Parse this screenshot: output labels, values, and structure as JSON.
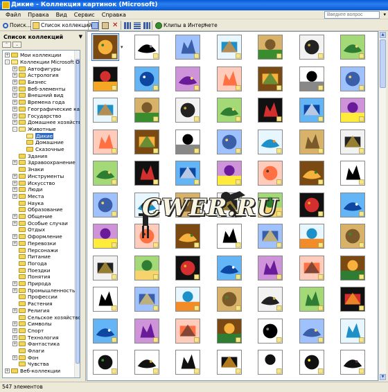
{
  "window": {
    "title": "Дикие - Коллекция картинок (Microsoft)"
  },
  "menu": {
    "items": [
      "Файл",
      "Правка",
      "Вид",
      "Сервис",
      "Справка"
    ],
    "help_placeholder": "Введите вопрос"
  },
  "toolbar": {
    "search_label": "Поиск...",
    "collections_label": "Список коллекций...",
    "web_clips_label": "Клипы в Интернете"
  },
  "left_panel": {
    "title": "Список коллекций",
    "tree": [
      {
        "label": "Мои коллекции",
        "indent": 0,
        "exp": "+"
      },
      {
        "label": "Коллекции Microsoft Office",
        "indent": 0,
        "exp": "-"
      },
      {
        "label": "Автофигуры",
        "indent": 1,
        "exp": "+"
      },
      {
        "label": "Астрология",
        "indent": 1,
        "exp": "+"
      },
      {
        "label": "Бизнес",
        "indent": 1,
        "exp": "+"
      },
      {
        "label": "Веб-элементы",
        "indent": 1,
        "exp": "+"
      },
      {
        "label": "Внешний вид",
        "indent": 1,
        "exp": "+"
      },
      {
        "label": "Времена года",
        "indent": 1,
        "exp": "+"
      },
      {
        "label": "Географические карты",
        "indent": 1,
        "exp": "+"
      },
      {
        "label": "Государство",
        "indent": 1,
        "exp": "+"
      },
      {
        "label": "Домашнее хозяйство",
        "indent": 1,
        "exp": "+"
      },
      {
        "label": "Животные",
        "indent": 1,
        "exp": "-"
      },
      {
        "label": "Дикие",
        "indent": 2,
        "exp": "",
        "selected": true
      },
      {
        "label": "Домашние",
        "indent": 2,
        "exp": ""
      },
      {
        "label": "Сказочные",
        "indent": 2,
        "exp": ""
      },
      {
        "label": "Здания",
        "indent": 1,
        "exp": ""
      },
      {
        "label": "Здравоохранение",
        "indent": 1,
        "exp": "+"
      },
      {
        "label": "Знаки",
        "indent": 1,
        "exp": ""
      },
      {
        "label": "Инструменты",
        "indent": 1,
        "exp": "+"
      },
      {
        "label": "Искусство",
        "indent": 1,
        "exp": "+"
      },
      {
        "label": "Люди",
        "indent": 1,
        "exp": "+"
      },
      {
        "label": "Места",
        "indent": 1,
        "exp": "+"
      },
      {
        "label": "Наука",
        "indent": 1,
        "exp": ""
      },
      {
        "label": "Образование",
        "indent": 1,
        "exp": ""
      },
      {
        "label": "Общение",
        "indent": 1,
        "exp": "+"
      },
      {
        "label": "Особые случаи",
        "indent": 1,
        "exp": "+"
      },
      {
        "label": "Отдых",
        "indent": 1,
        "exp": ""
      },
      {
        "label": "Оформление",
        "indent": 1,
        "exp": "+"
      },
      {
        "label": "Перевозки",
        "indent": 1,
        "exp": "+"
      },
      {
        "label": "Персонажи",
        "indent": 1,
        "exp": ""
      },
      {
        "label": "Питание",
        "indent": 1,
        "exp": ""
      },
      {
        "label": "Погода",
        "indent": 1,
        "exp": ""
      },
      {
        "label": "Поездки",
        "indent": 1,
        "exp": ""
      },
      {
        "label": "Понятия",
        "indent": 1,
        "exp": ""
      },
      {
        "label": "Природа",
        "indent": 1,
        "exp": "+"
      },
      {
        "label": "Промышленность",
        "indent": 1,
        "exp": "+"
      },
      {
        "label": "Професcии",
        "indent": 1,
        "exp": ""
      },
      {
        "label": "Растения",
        "indent": 1,
        "exp": ""
      },
      {
        "label": "Религия",
        "indent": 1,
        "exp": "+"
      },
      {
        "label": "Сельское хозяйство",
        "indent": 1,
        "exp": ""
      },
      {
        "label": "Символы",
        "indent": 1,
        "exp": "+"
      },
      {
        "label": "Спорт",
        "indent": 1,
        "exp": "+"
      },
      {
        "label": "Технология",
        "indent": 1,
        "exp": "+"
      },
      {
        "label": "Фантастика",
        "indent": 1,
        "exp": "+"
      },
      {
        "label": "Флаги",
        "indent": 1,
        "exp": ""
      },
      {
        "label": "Фон",
        "indent": 1,
        "exp": "+"
      },
      {
        "label": "Чувства",
        "indent": 1,
        "exp": ""
      },
      {
        "label": "Веб-коллекции",
        "indent": 0,
        "exp": "+"
      }
    ]
  },
  "grid": {
    "thumbnails": [
      [
        "tiger",
        "white-bird",
        "pelican-sign",
        "fish-arch",
        "tree-basket",
        "magnifier-bug",
        "gardener"
      ],
      [
        "grey-sketch",
        "lobster",
        "grey-animal",
        "sunset-tree",
        "fish-school",
        "yellow-trees",
        "letter-f"
      ],
      [
        "letter-n",
        "letter-o",
        "letter-z",
        "ostrich",
        "butterfly",
        "kid-gardener",
        "kid-walking"
      ],
      [
        "frog-doodle",
        "cityscape",
        "forest",
        "grey-bush",
        "red-flowers",
        "red-tulips",
        "red-bloom"
      ],
      [
        "red-tiger",
        "red-elephant",
        "red-lion",
        "red-monkey",
        "blue-fish",
        "blue-fish-2",
        "blue-dolphin"
      ],
      [
        "dark-flowers",
        "fox-tail",
        "blue-mask",
        "bee",
        "monkey-orange",
        "monkey-pink",
        "white-fish"
      ],
      [
        "sunset-boat",
        "fish-pattern",
        "lizard",
        "dark-bird",
        "white-dog",
        "umbrella-kid",
        "brown-animal"
      ],
      [
        "green-dance",
        "eagle",
        "bear-stamp",
        "camel-stamp",
        "desert-dunes",
        "desert-tree",
        "desert-animal"
      ],
      [
        "coral-reef",
        "road-sign",
        "kangaroo",
        "koala",
        "bear-grass",
        "coyote",
        "sparrow"
      ],
      [
        "turtle",
        "white-tiger",
        "frog",
        "gold-frog",
        "cheetah",
        "black-fish",
        "green-tiger"
      ],
      [
        "black-cat",
        "black-monkey",
        "black-bird",
        "lily-dancer",
        "black-fish-2",
        "couple-sign",
        "fly"
      ]
    ]
  },
  "watermark": {
    "text": "CWER.RU"
  },
  "status": {
    "count_label": "547 элементов"
  }
}
